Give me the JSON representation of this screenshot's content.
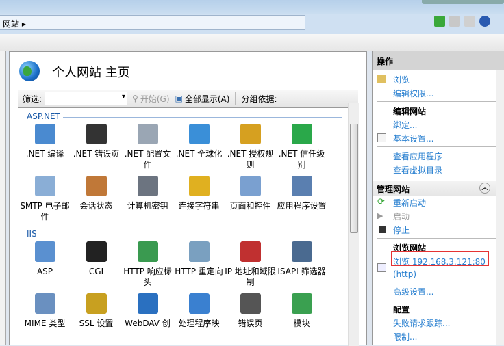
{
  "address": {
    "crumb": "网站",
    "arrow": "▸"
  },
  "page": {
    "title": "个人网站 主页"
  },
  "filter": {
    "label": "筛选:",
    "value": "",
    "go": "开始(G)",
    "show_all": "全部显示(A)",
    "group_by": "分组依据:"
  },
  "groups": [
    {
      "name": "ASP.NET",
      "features": [
        {
          "label": ".NET 编译",
          "color": "#4a8ad0"
        },
        {
          "label": ".NET 错误页",
          "color": "#333333"
        },
        {
          "label": ".NET 配置文件",
          "color": "#9aa6b4"
        },
        {
          "label": ".NET 全球化",
          "color": "#3a8fd8"
        },
        {
          "label": ".NET 授权规则",
          "color": "#d6a020"
        },
        {
          "label": ".NET 信任级别",
          "color": "#2aa84a"
        },
        {
          "label": "SMTP 电子邮件",
          "color": "#8aaed6"
        },
        {
          "label": "会话状态",
          "color": "#c07838"
        },
        {
          "label": "计算机密钥",
          "color": "#6c7480"
        },
        {
          "label": "连接字符串",
          "color": "#e0b020"
        },
        {
          "label": "页面和控件",
          "color": "#7aa0d0"
        },
        {
          "label": "应用程序设置",
          "color": "#5a7fb0"
        }
      ]
    },
    {
      "name": "IIS",
      "features": [
        {
          "label": "ASP",
          "color": "#5a90d0"
        },
        {
          "label": "CGI",
          "color": "#222222"
        },
        {
          "label": "HTTP 响应标头",
          "color": "#3a9a50"
        },
        {
          "label": "HTTP 重定向",
          "color": "#7aa0c0"
        },
        {
          "label": "IP 地址和域限制",
          "color": "#c03030"
        },
        {
          "label": "ISAPI 筛选器",
          "color": "#4a6a90"
        },
        {
          "label": "MIME 类型",
          "color": "#6a90c0"
        },
        {
          "label": "SSL 设置",
          "color": "#c8a020"
        },
        {
          "label": "WebDAV 创",
          "color": "#2a70c0"
        },
        {
          "label": "处理程序映",
          "color": "#3a80d0"
        },
        {
          "label": "错误页",
          "color": "#555555"
        },
        {
          "label": "模块",
          "color": "#3aa050"
        }
      ]
    }
  ],
  "actions": {
    "title": "操作",
    "items1": [
      {
        "label": "浏览",
        "icon": "browse-folder-icon"
      },
      {
        "label": "编辑权限..."
      }
    ],
    "edit_site": {
      "title": "编辑网站",
      "items": [
        {
          "label": "绑定..."
        },
        {
          "label": "基本设置...",
          "icon": "settings-icon"
        }
      ]
    },
    "views": [
      {
        "label": "查看应用程序"
      },
      {
        "label": "查看虚拟目录"
      }
    ],
    "manage": {
      "title": "管理网站",
      "restart": "重新启动",
      "start": "启动",
      "stop": "停止"
    },
    "browse_site": {
      "title": "浏览网站",
      "link": "浏览 192.168.3.121:80",
      "proto": "(http)"
    },
    "advanced": "高级设置...",
    "config": {
      "title": "配置",
      "items": [
        "失败请求跟踪...",
        "限制..."
      ]
    }
  },
  "highlight_color": "#e53333"
}
